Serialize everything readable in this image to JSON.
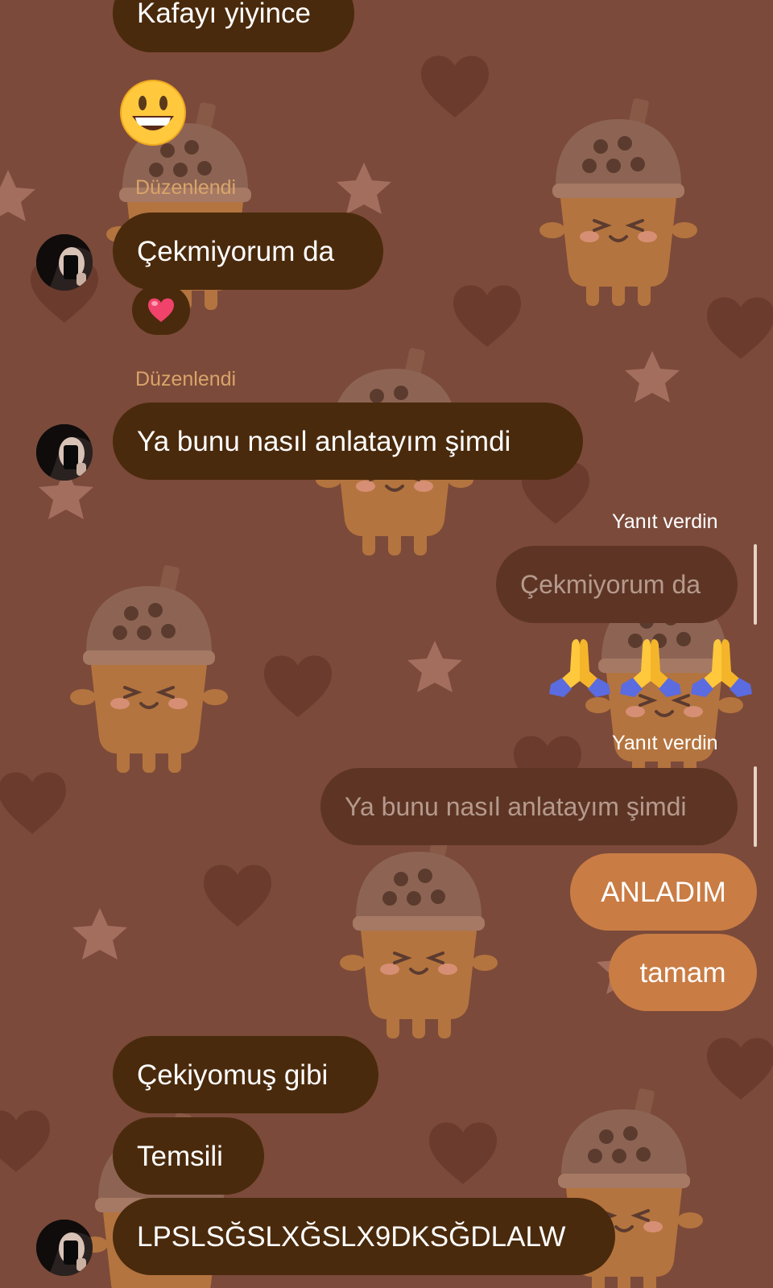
{
  "chat": {
    "messages": {
      "kafayi": "Kafayı yiyince",
      "cekmiyorum": "Çekmiyorum da",
      "ya_bunu": "Ya bunu nasıl anlatayım şimdi",
      "cekiyomus": "Çekiyomuş gibi",
      "temsili": "Temsili",
      "lpsl": "LPSLSĞSLXĞSLX9DKSĞDLALW"
    },
    "labels": {
      "edited": "Düzenlendi",
      "replied": "Yanıt verdin"
    },
    "replies": {
      "quote1": "Çekmiyorum da",
      "quote2": "Ya bunu nasıl anlatayım şimdi"
    },
    "sent": {
      "anladim": "ANLADIM",
      "tamam": "tamam"
    }
  },
  "icons": {
    "smiley": "smiley-emoji-icon",
    "heart_reaction": "red-heart-reaction-icon",
    "praying_hands": "praying-hands-emoji-icon",
    "avatar": "contact-avatar-image"
  },
  "colors": {
    "wallpaper": "#7b4a3a",
    "incoming_bubble": "#4a2a0c",
    "outgoing_bubble": "#c97c44",
    "quote_bubble": "#5e3525",
    "edited_label": "#d9a46a"
  }
}
